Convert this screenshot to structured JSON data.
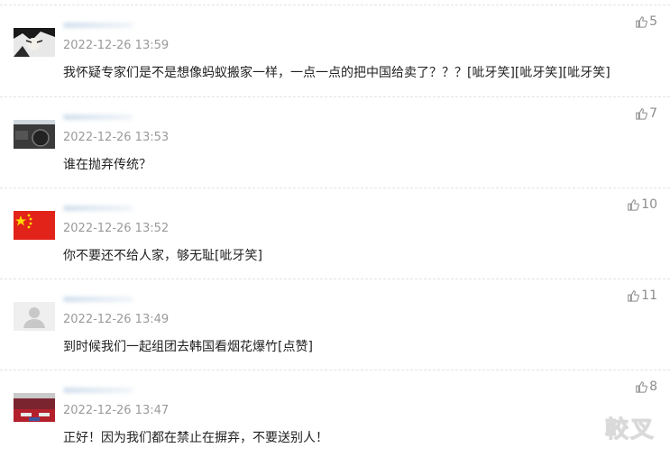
{
  "comments": [
    {
      "time": "2022-12-26 13:59",
      "text": "我怀疑专家们是不是想像蚂蚁搬家一样，一点一点的把中国给卖了？？？[呲牙笑][呲牙笑][呲牙笑]",
      "likes": "5",
      "avatar": "anime-face"
    },
    {
      "time": "2022-12-26 13:53",
      "text": "谁在抛弃传统？",
      "likes": "7",
      "avatar": "car-dashboard"
    },
    {
      "time": "2022-12-26 13:52",
      "text": "你不要还不给人家，够无耻[呲牙笑]",
      "likes": "10",
      "avatar": "red-flag"
    },
    {
      "time": "2022-12-26 13:49",
      "text": "到时候我们一起组团去韩国看烟花爆竹[点赞]",
      "likes": "11",
      "avatar": "default-user"
    },
    {
      "time": "2022-12-26 13:47",
      "text": "正好！因为我们都在禁止在摒弃，不要送别人！",
      "likes": "8",
      "avatar": "red-car"
    }
  ],
  "watermark": "較叉",
  "colors": {
    "time": "#9a9a9a",
    "text": "#222222",
    "likes": "#8c8c8c",
    "divider": "#e3e3e3"
  }
}
